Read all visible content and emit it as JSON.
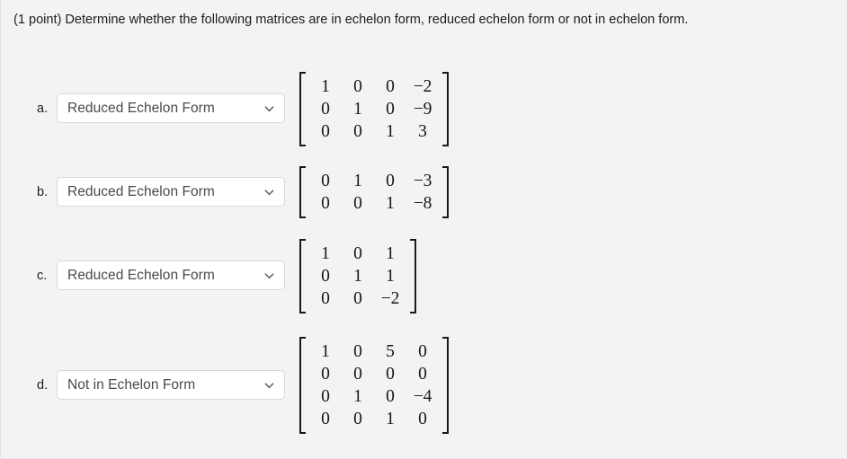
{
  "question": "(1 point) Determine whether the following matrices are in echelon form, reduced echelon form or not in echelon form.",
  "dropdown_icon": "chevron-down-icon",
  "colors": {
    "page_background": "#f3f3f3",
    "select_background": "#ffffff",
    "select_border": "#d8d8d8",
    "text": "#1c1c1c",
    "select_text": "#4a4a4a",
    "matrix_text": "#161616"
  },
  "options": [
    "Echelon Form",
    "Reduced Echelon Form",
    "Not in Echelon Form"
  ],
  "items": [
    {
      "label": "a.",
      "selected": "Reduced Echelon Form",
      "matrix": [
        [
          "1",
          "0",
          "0",
          "−2"
        ],
        [
          "0",
          "1",
          "0",
          "−9"
        ],
        [
          "0",
          "0",
          "1",
          "3"
        ]
      ]
    },
    {
      "label": "b.",
      "selected": "Reduced Echelon Form",
      "matrix": [
        [
          "0",
          "1",
          "0",
          "−3"
        ],
        [
          "0",
          "0",
          "1",
          "−8"
        ]
      ]
    },
    {
      "label": "c.",
      "selected": "Reduced Echelon Form",
      "matrix": [
        [
          "1",
          "0",
          "1"
        ],
        [
          "0",
          "1",
          "1"
        ],
        [
          "0",
          "0",
          "−2"
        ]
      ]
    },
    {
      "label": "d.",
      "selected": "Not in Echelon Form",
      "matrix": [
        [
          "1",
          "0",
          "5",
          "0"
        ],
        [
          "0",
          "0",
          "0",
          "0"
        ],
        [
          "0",
          "1",
          "0",
          "−4"
        ],
        [
          "0",
          "0",
          "1",
          "0"
        ]
      ]
    }
  ]
}
